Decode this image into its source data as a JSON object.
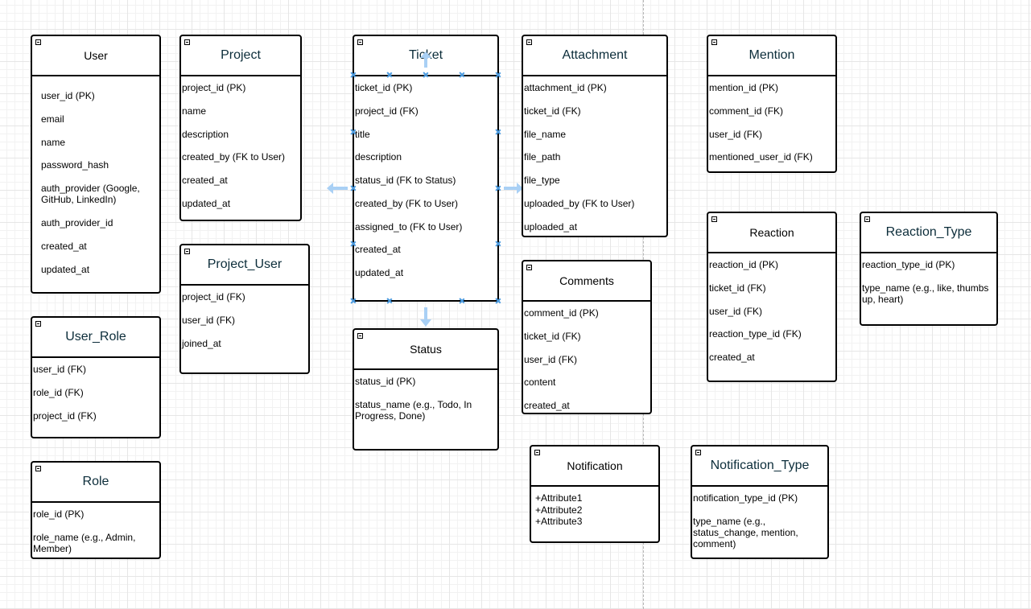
{
  "entities": {
    "user": {
      "name": "User",
      "fields": [
        "user_id (PK)",
        "email",
        "name",
        "password_hash",
        "auth_provider (Google, GitHub, LinkedIn)",
        "auth_provider_id",
        "created_at",
        "updated_at"
      ]
    },
    "project": {
      "name": "Project",
      "fields": [
        "project_id (PK)",
        "name",
        "description",
        "created_by (FK to User)",
        "created_at",
        "updated_at"
      ]
    },
    "ticket": {
      "name": "Ticket",
      "fields": [
        "ticket_id (PK)",
        "project_id (FK)",
        "title",
        "description",
        "status_id (FK to Status)",
        "created_by (FK to User)",
        "assigned_to (FK to User)",
        "created_at",
        "updated_at"
      ]
    },
    "attachment": {
      "name": "Attachment",
      "fields": [
        "attachment_id (PK)",
        "ticket_id (FK)",
        "file_name",
        "file_path",
        "file_type",
        "uploaded_by (FK to User)",
        "uploaded_at"
      ]
    },
    "mention": {
      "name": "Mention",
      "fields": [
        "mention_id (PK)",
        "comment_id (FK)",
        "user_id (FK)",
        "mentioned_user_id (FK)"
      ]
    },
    "project_user": {
      "name": "Project_User",
      "fields": [
        "project_id (FK)",
        "user_id (FK)",
        "joined_at"
      ]
    },
    "user_role": {
      "name": "User_Role",
      "fields": [
        "user_id (FK)",
        "role_id (FK)",
        "project_id (FK)"
      ]
    },
    "role": {
      "name": "Role",
      "fields": [
        "role_id (PK)",
        "role_name (e.g., Admin, Member)"
      ]
    },
    "status": {
      "name": "Status",
      "fields": [
        "status_id (PK)",
        "status_name (e.g., Todo, In Progress, Done)"
      ]
    },
    "comments": {
      "name": "Comments",
      "fields": [
        "comment_id (PK)",
        "ticket_id (FK)",
        "user_id (FK)",
        "content",
        "created_at"
      ]
    },
    "reaction": {
      "name": "Reaction",
      "fields": [
        "reaction_id (PK)",
        "ticket_id (FK)",
        "user_id (FK)",
        "reaction_type_id (FK)",
        "created_at"
      ]
    },
    "reaction_type": {
      "name": "Reaction_Type",
      "fields": [
        "reaction_type_id (PK)",
        "type_name (e.g., like, thumbs up, heart)"
      ]
    },
    "notification": {
      "name": "Notification",
      "attributes": "+Attribute1\n+Attribute2\n+Attribute3"
    },
    "notification_type": {
      "name": "Notification_Type",
      "fields": [
        "notification_type_id (PK)",
        "type_name (e.g., status_change, mention, comment)"
      ]
    }
  },
  "colors": {
    "border": "#000000",
    "title_dark": "#0c2d3a",
    "grid_major": "#e6e6e6",
    "grid_minor": "#f2f2f2",
    "selection_handle": "#4b9be0",
    "hover_arrow": "#a9d0f5"
  }
}
